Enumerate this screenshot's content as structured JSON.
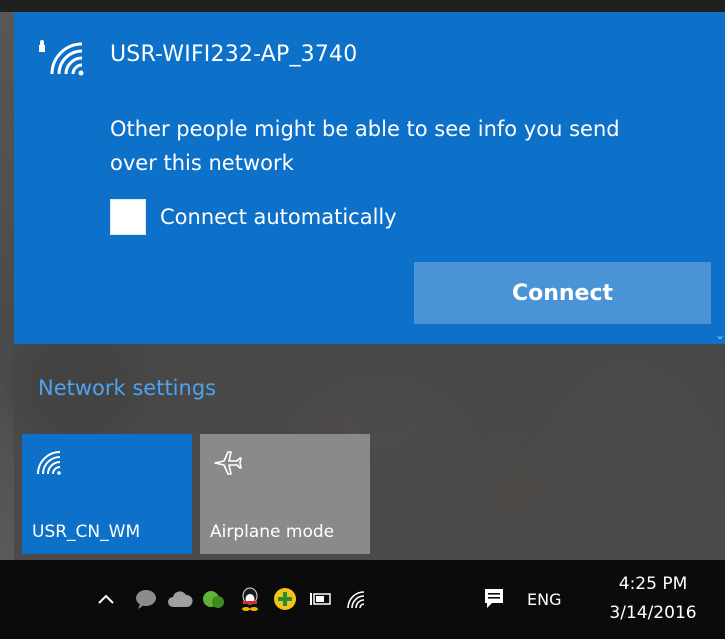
{
  "network": {
    "ssid": "USR-WIFI232-AP_3740",
    "warning": "Other people might be able to see info you send over this network",
    "connect_automatically_label": "Connect automatically",
    "connect_automatically_checked": false,
    "connect_label": "Connect"
  },
  "settings": {
    "network_settings_label": "Network settings"
  },
  "quick_actions": [
    {
      "label": "USR_CN_WM",
      "icon": "wifi-icon",
      "active": true
    },
    {
      "label": "Airplane mode",
      "icon": "airplane-icon",
      "active": false
    }
  ],
  "taskbar": {
    "tray_icons": [
      "chevron-up-icon",
      "chat-bubble-icon",
      "cloud-icon",
      "green-app-icon",
      "qq-penguin-icon",
      "plus-circle-icon",
      "battery-icon",
      "wifi-icon",
      "action-center-icon"
    ],
    "language": "ENG",
    "time": "4:25 PM",
    "date": "3/14/2016"
  },
  "colors": {
    "accent": "#0e71c9",
    "connect_button": "#4a93d6",
    "link": "#4da3f0",
    "tile_inactive": "#8a8a8a",
    "taskbar": "#0b0b0b"
  }
}
